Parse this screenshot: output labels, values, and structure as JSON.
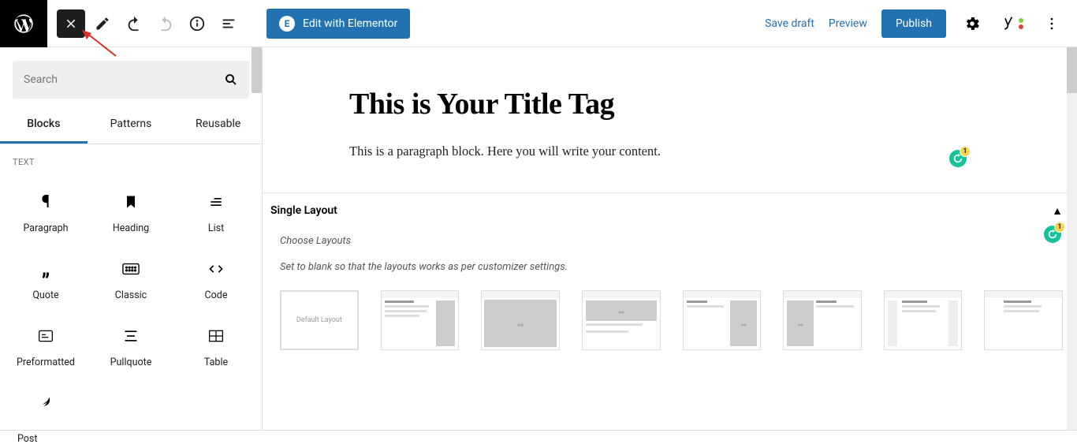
{
  "topbar": {
    "elementor_label": "Edit with Elementor",
    "elementor_icon_text": "E",
    "save_draft": "Save draft",
    "preview": "Preview",
    "publish": "Publish"
  },
  "sidebar": {
    "search_placeholder": "Search",
    "tabs": [
      {
        "label": "Blocks",
        "active": true
      },
      {
        "label": "Patterns",
        "active": false
      },
      {
        "label": "Reusable",
        "active": false
      }
    ],
    "section_label": "TEXT",
    "blocks": [
      {
        "name": "paragraph",
        "label": "Paragraph"
      },
      {
        "name": "heading",
        "label": "Heading"
      },
      {
        "name": "list",
        "label": "List"
      },
      {
        "name": "quote",
        "label": "Quote"
      },
      {
        "name": "classic",
        "label": "Classic"
      },
      {
        "name": "code",
        "label": "Code"
      },
      {
        "name": "preformatted",
        "label": "Preformatted"
      },
      {
        "name": "pullquote",
        "label": "Pullquote"
      },
      {
        "name": "table",
        "label": "Table"
      }
    ]
  },
  "editor": {
    "title": "This is Your Title Tag",
    "paragraph": "This is a paragraph block.  Here you will write your content."
  },
  "single_layout": {
    "heading": "Single Layout",
    "instr1": "Choose Layouts",
    "instr2": "Set to blank so that the layouts works as per customizer settings.",
    "default_label": "Default Layout"
  },
  "footer": {
    "breadcrumb": "Post"
  },
  "grammarly": {
    "count": "1"
  },
  "yoast": {
    "dot1": "#7ad03a",
    "dot2": "#e24040"
  }
}
